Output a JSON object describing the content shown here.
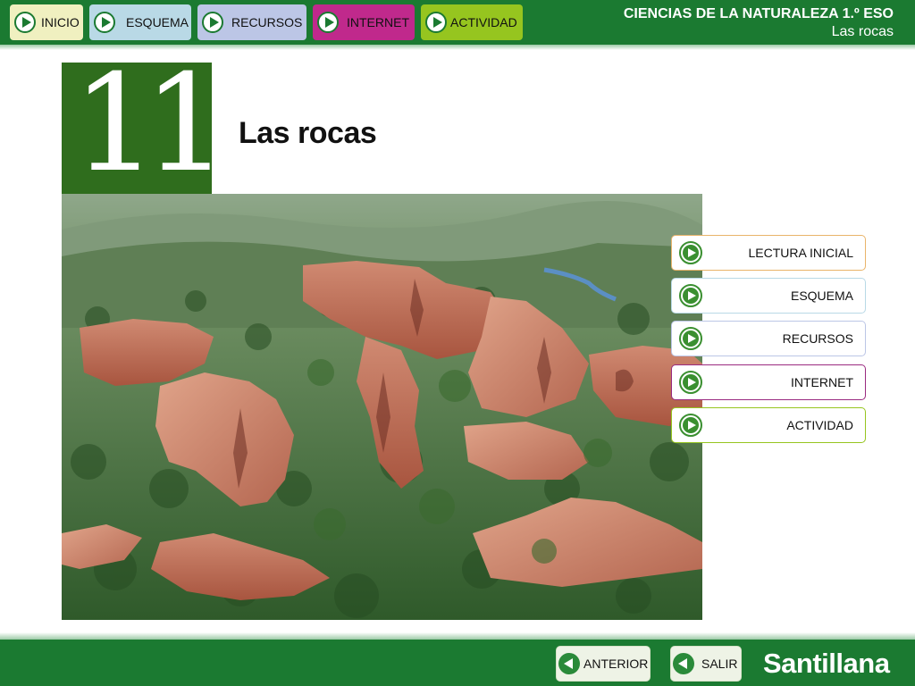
{
  "header": {
    "title": "CIENCIAS DE LA NATURALEZA 1.º ESO",
    "subtitle": "Las rocas"
  },
  "topnav": {
    "items": [
      {
        "label": "INICIO",
        "color": "#f0f0c0"
      },
      {
        "label": "ESQUEMA",
        "color": "#b9d9e6"
      },
      {
        "label": "RECURSOS",
        "color": "#bcc6e6"
      },
      {
        "label": "INTERNET",
        "color": "#c0298c"
      },
      {
        "label": "ACTIVIDAD",
        "color": "#96c51f"
      }
    ]
  },
  "chapter": {
    "number": "11",
    "title": "Las rocas"
  },
  "side_menu": {
    "items": [
      {
        "label": "LECTURA INICIAL",
        "border": "#e9b46a"
      },
      {
        "label": "ESQUEMA",
        "border": "#b9d9e6"
      },
      {
        "label": "RECURSOS",
        "border": "#bcc6e6"
      },
      {
        "label": "INTERNET",
        "border": "#9a2a80"
      },
      {
        "label": "ACTIVIDAD",
        "border": "#96c51f"
      }
    ]
  },
  "footer": {
    "prev_label": "ANTERIOR",
    "exit_label": "SALIR",
    "brand": "Santillana"
  },
  "colors": {
    "bar_green": "#1b7a31",
    "chapter_green": "#2f6d1d"
  }
}
